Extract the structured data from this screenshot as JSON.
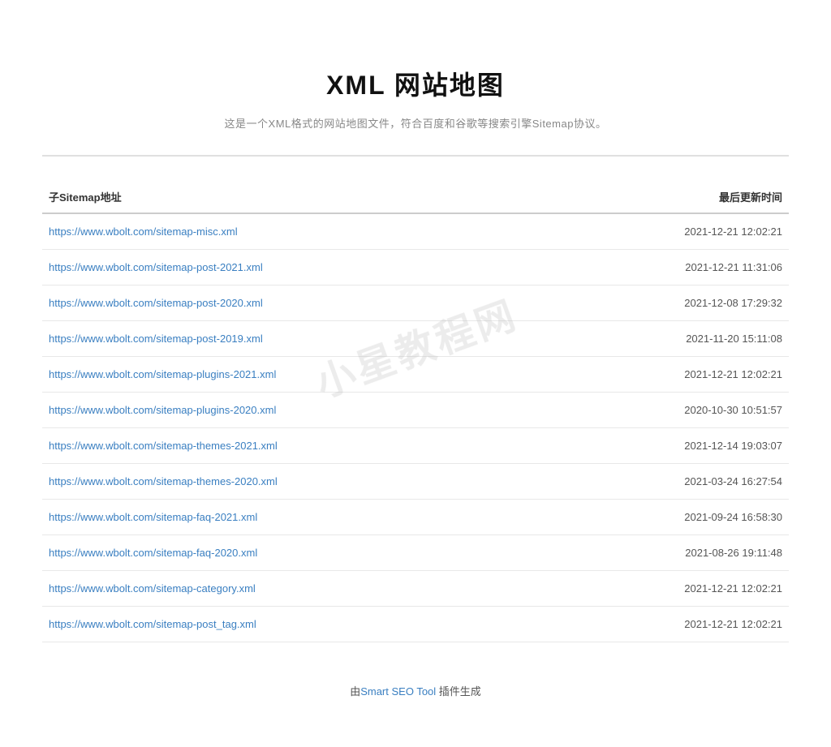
{
  "header": {
    "title": "XML 网站地图",
    "subtitle": "这是一个XML格式的网站地图文件，符合百度和谷歌等搜索引擎Sitemap协议。"
  },
  "table": {
    "col_url_label": "子Sitemap地址",
    "col_date_label": "最后更新时间",
    "rows": [
      {
        "url": "https://www.wbolt.com/sitemap-misc.xml",
        "date": "2021-12-21 12:02:21"
      },
      {
        "url": "https://www.wbolt.com/sitemap-post-2021.xml",
        "date": "2021-12-21 11:31:06"
      },
      {
        "url": "https://www.wbolt.com/sitemap-post-2020.xml",
        "date": "2021-12-08 17:29:32"
      },
      {
        "url": "https://www.wbolt.com/sitemap-post-2019.xml",
        "date": "2021-11-20 15:11:08"
      },
      {
        "url": "https://www.wbolt.com/sitemap-plugins-2021.xml",
        "date": "2021-12-21 12:02:21"
      },
      {
        "url": "https://www.wbolt.com/sitemap-plugins-2020.xml",
        "date": "2020-10-30 10:51:57"
      },
      {
        "url": "https://www.wbolt.com/sitemap-themes-2021.xml",
        "date": "2021-12-14 19:03:07"
      },
      {
        "url": "https://www.wbolt.com/sitemap-themes-2020.xml",
        "date": "2021-03-24 16:27:54"
      },
      {
        "url": "https://www.wbolt.com/sitemap-faq-2021.xml",
        "date": "2021-09-24 16:58:30"
      },
      {
        "url": "https://www.wbolt.com/sitemap-faq-2020.xml",
        "date": "2021-08-26 19:11:48"
      },
      {
        "url": "https://www.wbolt.com/sitemap-category.xml",
        "date": "2021-12-21 12:02:21"
      },
      {
        "url": "https://www.wbolt.com/sitemap-post_tag.xml",
        "date": "2021-12-21 12:02:21"
      }
    ]
  },
  "watermark": {
    "text": "小星教程网"
  },
  "footer": {
    "prefix": "由",
    "link_text": "Smart SEO Tool",
    "suffix": " 插件生成"
  }
}
